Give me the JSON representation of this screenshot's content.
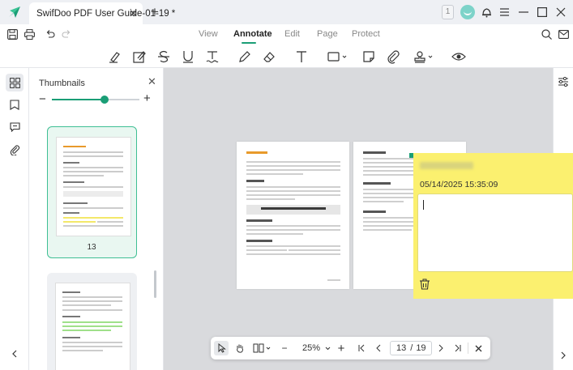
{
  "window": {
    "tab_title": "SwifDoo PDF User Guide-01-19 *",
    "badge_count": "1"
  },
  "menu": {
    "tabs": [
      {
        "label": "View"
      },
      {
        "label": "Annotate"
      },
      {
        "label": "Edit"
      },
      {
        "label": "Page"
      },
      {
        "label": "Protect"
      }
    ],
    "active_tab": "Annotate"
  },
  "thumbnails": {
    "title": "Thumbnails",
    "zoom_level": 0.6,
    "pages": [
      {
        "number": "13",
        "selected": true
      },
      {
        "number": "",
        "selected": false
      }
    ]
  },
  "note": {
    "date": "05/14/2025 15:35:09",
    "text": ""
  },
  "bottom": {
    "zoom": "25%",
    "current_page": "13",
    "page_separator": "/",
    "total_pages": "19"
  },
  "colors": {
    "accent": "#1a9e76",
    "note_bg": "#fbf06f",
    "highlight_green": "#9fe08a",
    "highlight_yellow": "#f3e86a",
    "canvas_bg": "#d9dadd"
  }
}
